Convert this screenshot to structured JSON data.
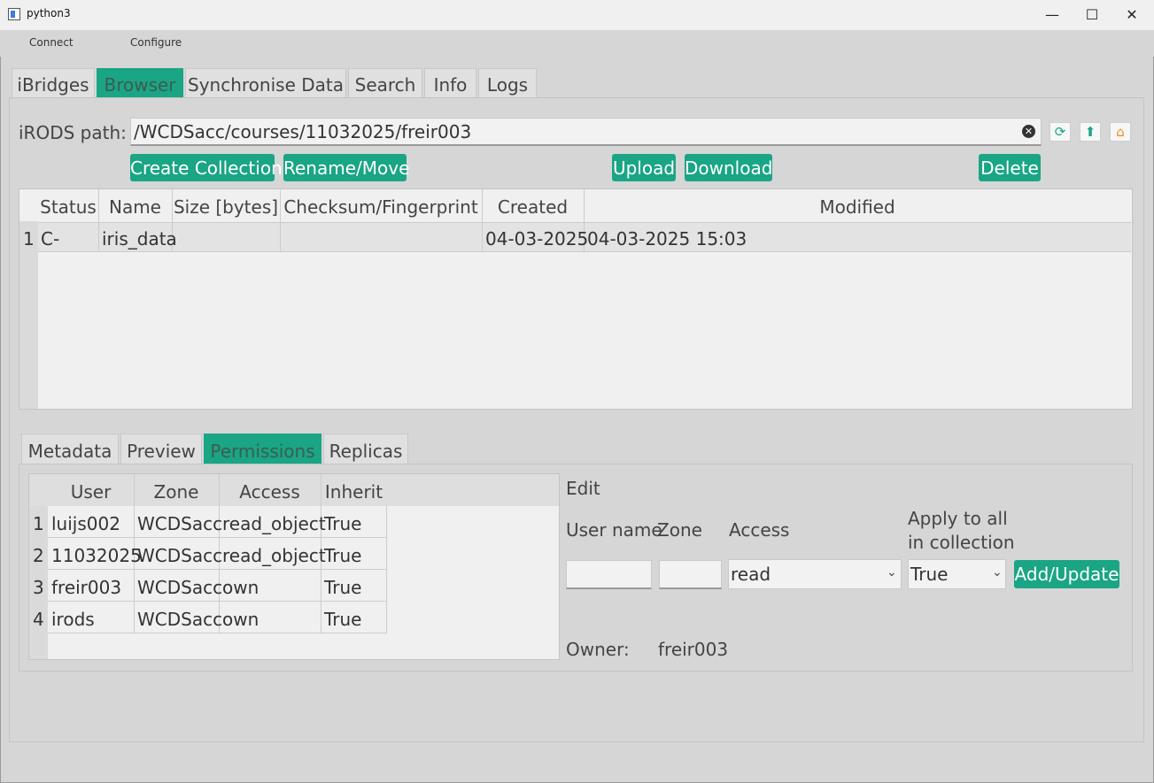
{
  "window": {
    "title": "python3",
    "minimize": "—",
    "maximize": "☐",
    "close": "✕"
  },
  "menu": [
    "Connect",
    "Configure"
  ],
  "tabs": [
    "iBridges",
    "Browser",
    "Synchronise Data",
    "Search",
    "Info",
    "Logs"
  ],
  "path": {
    "label": "iRODS path:",
    "value": "/WCDSacc/courses/11032025/freir003",
    "clear": "✕"
  },
  "path_buttons": {
    "refresh": "⟳",
    "up": "⬆",
    "home": "⌂"
  },
  "actions": {
    "create": "Create Collection",
    "rename": "Rename/Move",
    "upload": "Upload",
    "download": "Download",
    "delete": "Delete"
  },
  "browser_table": {
    "headers": [
      "Status",
      "Name",
      "Size [bytes]",
      "Checksum/Fingerprint",
      "Created",
      "Modified"
    ],
    "rows": [
      {
        "num": "1",
        "status": "C-",
        "name": "iris_data",
        "size": "",
        "checksum": "",
        "created": "04-03-2025",
        "modified": "04-03-2025 15:03"
      }
    ]
  },
  "subtabs": [
    "Metadata",
    "Preview",
    "Permissions",
    "Replicas"
  ],
  "perm_table": {
    "headers": [
      "User",
      "Zone",
      "Access",
      "Inherit"
    ],
    "rows": [
      {
        "num": "1",
        "user": "luijs002",
        "zone": "WCDSacc",
        "access": "read_object",
        "inherit": "True"
      },
      {
        "num": "2",
        "user": "11032025",
        "zone": "WCDSacc",
        "access": "read_object",
        "inherit": "True"
      },
      {
        "num": "3",
        "user": "freir003",
        "zone": "WCDSacc",
        "access": "own",
        "inherit": "True"
      },
      {
        "num": "4",
        "user": "irods",
        "zone": "WCDSacc",
        "access": "own",
        "inherit": "True"
      }
    ]
  },
  "edit": {
    "title": "Edit",
    "user_name_label": "User name",
    "zone_label": "Zone",
    "access_label": "Access",
    "apply_label_1": "Apply to all",
    "apply_label_2": "in collection",
    "access_value": "read",
    "apply_value": "True",
    "add_button": "Add/Update",
    "chevron": "⌄"
  },
  "owner": {
    "label": "Owner:",
    "value": "freir003"
  },
  "colors": {
    "accent": "#1aa584",
    "background": "#d6d6d6"
  }
}
